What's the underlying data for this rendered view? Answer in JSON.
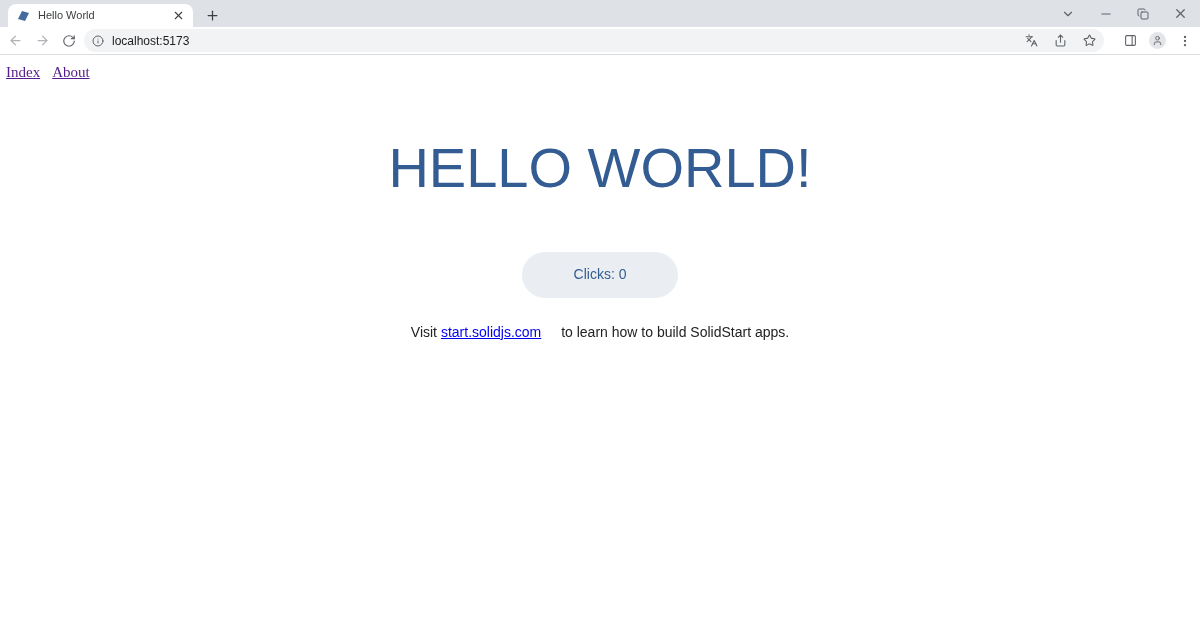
{
  "browser": {
    "tabs": [
      {
        "title": "Hello World",
        "selected": true
      }
    ],
    "address": "localhost:5173"
  },
  "nav": [
    {
      "label": "Index"
    },
    {
      "label": "About"
    }
  ],
  "heading": "HELLO WORLD!",
  "counter_button": "Clicks: 0",
  "footer_text": {
    "before": "Visit",
    "link": "start.solidjs.com",
    "after": "to learn how to build SolidStart apps."
  }
}
